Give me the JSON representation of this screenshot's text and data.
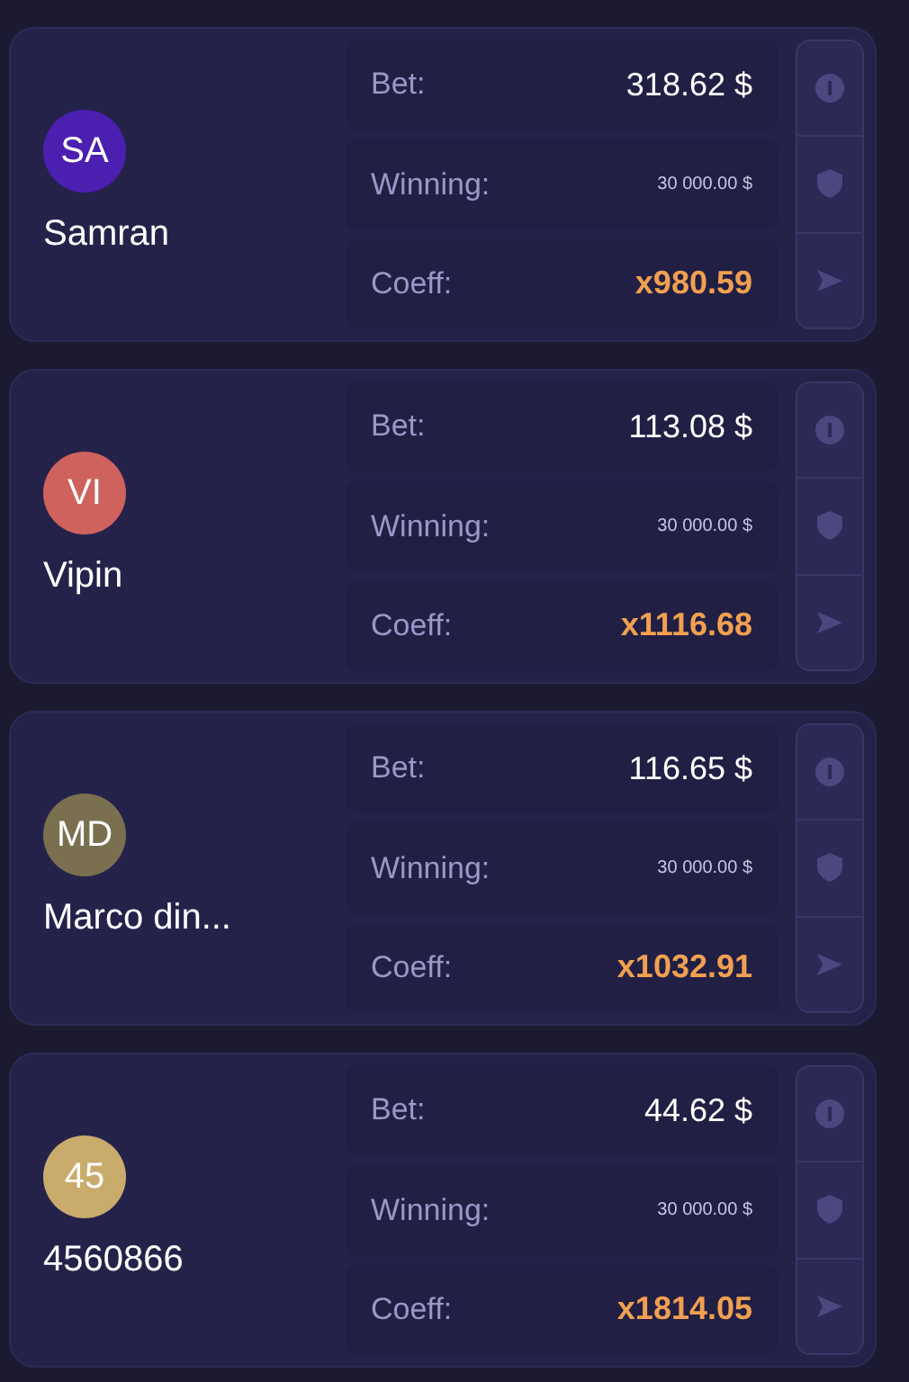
{
  "players": [
    {
      "initials": "SA",
      "color": "#4b1fb0",
      "name": "Samran",
      "bet_label": "Bet:",
      "bet": "318.62 $",
      "winning_label": "Winning:",
      "winning": "30 000.00 $",
      "coeff_label": "Coeff:",
      "coeff": "x980.59"
    },
    {
      "initials": "VI",
      "color": "#d0625e",
      "name": "Vipin",
      "bet_label": "Bet:",
      "bet": "113.08 $",
      "winning_label": "Winning:",
      "winning": "30 000.00 $",
      "coeff_label": "Coeff:",
      "coeff": "x1116.68"
    },
    {
      "initials": "MD",
      "color": "#7a7050",
      "name": "Marco din...",
      "bet_label": "Bet:",
      "bet": "116.65 $",
      "winning_label": "Winning:",
      "winning": "30 000.00 $",
      "coeff_label": "Coeff:",
      "coeff": "x1032.91"
    },
    {
      "initials": "45",
      "color": "#c9ac6c",
      "name": "4560866",
      "bet_label": "Bet:",
      "bet": "44.62 $",
      "winning_label": "Winning:",
      "winning": "30 000.00 $",
      "coeff_label": "Coeff:",
      "coeff": "x1814.05"
    }
  ]
}
